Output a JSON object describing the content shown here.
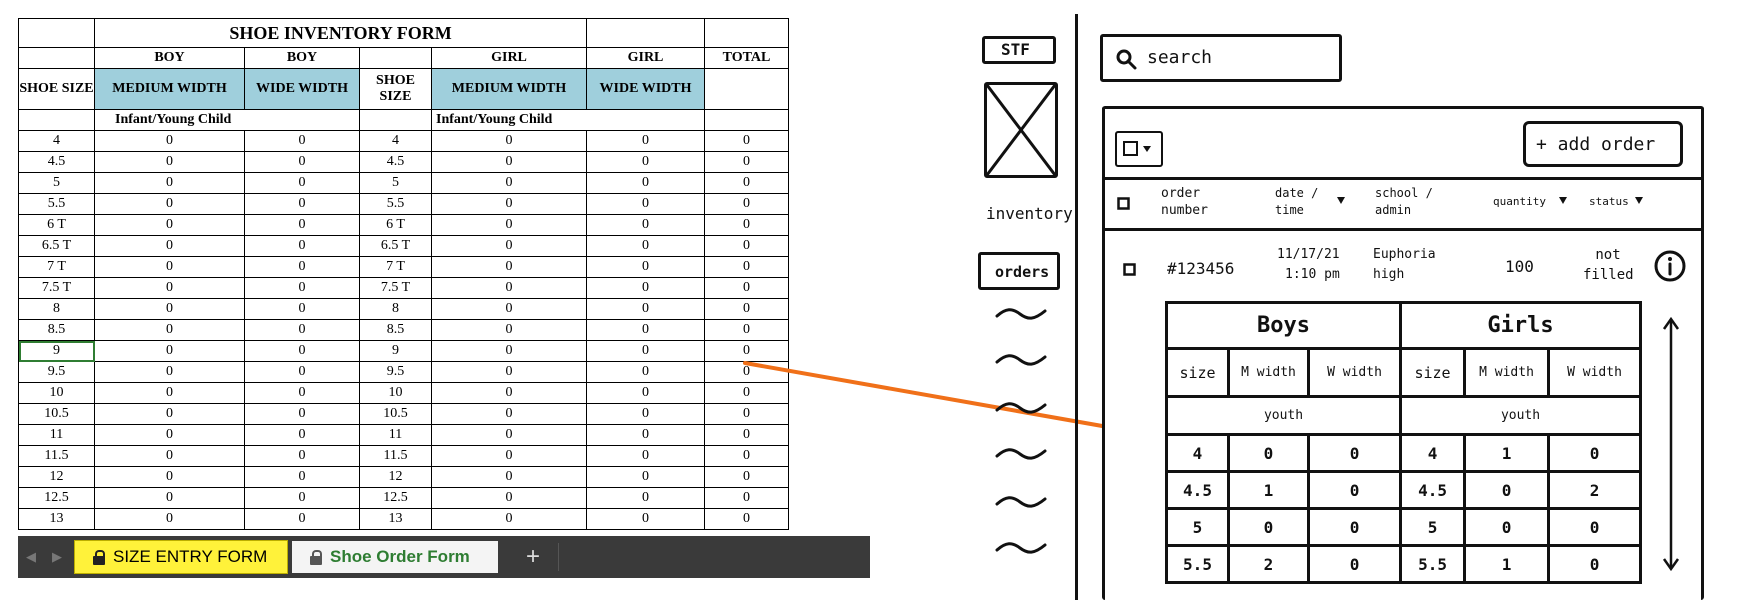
{
  "spreadsheet": {
    "title": "SHOE INVENTORY FORM",
    "group_headers": [
      "BOY",
      "BOY",
      "GIRL",
      "GIRL",
      "TOTAL"
    ],
    "size_header": "SHOE SIZE",
    "width_headers": [
      "MEDIUM WIDTH",
      "WIDE WIDTH",
      "MEDIUM WIDTH",
      "WIDE WIDTH"
    ],
    "age_label": "Infant/Young Child",
    "rows": [
      [
        "4",
        "0",
        "0",
        "4",
        "0",
        "0",
        "0"
      ],
      [
        "4.5",
        "0",
        "0",
        "4.5",
        "0",
        "0",
        "0"
      ],
      [
        "5",
        "0",
        "0",
        "5",
        "0",
        "0",
        "0"
      ],
      [
        "5.5",
        "0",
        "0",
        "5.5",
        "0",
        "0",
        "0"
      ],
      [
        "6 T",
        "0",
        "0",
        "6 T",
        "0",
        "0",
        "0"
      ],
      [
        "6.5 T",
        "0",
        "0",
        "6.5 T",
        "0",
        "0",
        "0"
      ],
      [
        "7 T",
        "0",
        "0",
        "7 T",
        "0",
        "0",
        "0"
      ],
      [
        "7.5 T",
        "0",
        "0",
        "7.5 T",
        "0",
        "0",
        "0"
      ],
      [
        "8",
        "0",
        "0",
        "8",
        "0",
        "0",
        "0"
      ],
      [
        "8.5",
        "0",
        "0",
        "8.5",
        "0",
        "0",
        "0"
      ],
      [
        "9",
        "0",
        "0",
        "9",
        "0",
        "0",
        "0"
      ],
      [
        "9.5",
        "0",
        "0",
        "9.5",
        "0",
        "0",
        "0"
      ],
      [
        "10",
        "0",
        "0",
        "10",
        "0",
        "0",
        "0"
      ],
      [
        "10.5",
        "0",
        "0",
        "10.5",
        "0",
        "0",
        "0"
      ],
      [
        "11",
        "0",
        "0",
        "11",
        "0",
        "0",
        "0"
      ],
      [
        "11.5",
        "0",
        "0",
        "11.5",
        "0",
        "0",
        "0"
      ],
      [
        "12",
        "0",
        "0",
        "12",
        "0",
        "0",
        "0"
      ],
      [
        "12.5",
        "0",
        "0",
        "12.5",
        "0",
        "0",
        "0"
      ],
      [
        "13",
        "0",
        "0",
        "13",
        "0",
        "0",
        "0"
      ]
    ],
    "selected_row": 10,
    "tabs": {
      "size_entry": "SIZE ENTRY FORM",
      "shoe_order": "Shoe Order Form",
      "add": "+"
    },
    "colors": {
      "header_blue": "#9fcfdc",
      "tab_yellow": "#fff23a",
      "tab_green": "#2e7d32",
      "arrow": "#f07019"
    }
  },
  "wireframe": {
    "logo": "STF",
    "search_placeholder": "search",
    "nav": {
      "inventory": "inventory",
      "orders": "orders"
    },
    "add_order": "+ add order",
    "columns": [
      "order number",
      "date / time",
      "school / admin",
      "quantity",
      "status"
    ],
    "order": {
      "number": "#123456",
      "date": "11/17/21",
      "time": "1:10 pm",
      "school": "Euphoria high",
      "quantity": "100",
      "status": "not filled"
    },
    "detail": {
      "boys": "Boys",
      "girls": "Girls",
      "size": "size",
      "m_width": "M width",
      "w_width": "W width",
      "youth": "youth",
      "rows": [
        [
          "4",
          "0",
          "0",
          "4",
          "1",
          "0"
        ],
        [
          "4.5",
          "1",
          "0",
          "4.5",
          "0",
          "2"
        ],
        [
          "5",
          "0",
          "0",
          "5",
          "0",
          "0"
        ],
        [
          "5.5",
          "2",
          "0",
          "5.5",
          "1",
          "0"
        ]
      ]
    },
    "icons": [
      "search-icon",
      "image-placeholder-icon",
      "checkbox-dropdown-icon",
      "info-icon",
      "scroll-arrow-icon",
      "sort-caret-icon"
    ]
  }
}
